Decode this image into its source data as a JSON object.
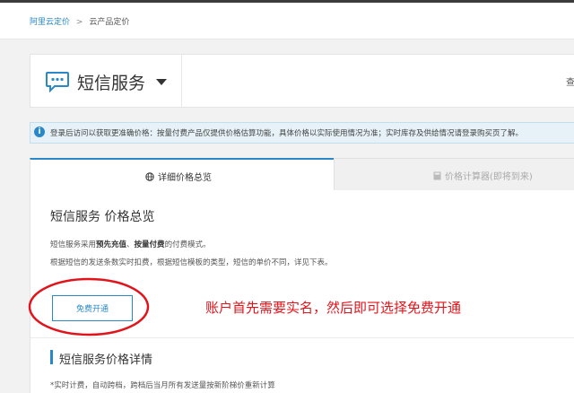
{
  "breadcrumb": {
    "home": "阿里云定价",
    "separator": ">",
    "current": "云产品定价"
  },
  "product": {
    "name": "短信服务",
    "right_link": "查"
  },
  "notice": {
    "text": "登录后访问以获取更准确价格：按量付费产品仅提供价格估算功能，具体价格以实际使用情况为准；实时库存及供给情况请登录购买页了解。"
  },
  "tabs": [
    {
      "label": "详细价格总览",
      "icon": "globe-icon",
      "active": true
    },
    {
      "label": "价格计算器(即将到来)",
      "icon": "calculator-icon",
      "active": false
    }
  ],
  "overview": {
    "title": "短信服务 价格总览",
    "desc1_prefix": "短信服务采用",
    "desc1_bold1": "预先充值",
    "desc1_mid": "、",
    "desc1_bold2": "按量付费",
    "desc1_suffix": "的付费模式。",
    "desc2": "根据短信的发送条数实时扣费，根据短信模板的类型，短信的单价不同，详见下表。",
    "free_button": "免费开通"
  },
  "annotation": "账户首先需要实名，然后即可选择免费开通",
  "details": {
    "title": "短信服务价格详情",
    "footnote": "*实时计费，自动跨档，跨档后当月所有发送量按新阶梯价重新计算"
  },
  "colors": {
    "accent": "#2a88c8",
    "annotation_red": "#e2141b",
    "notice_bg": "#e6f2f8"
  }
}
